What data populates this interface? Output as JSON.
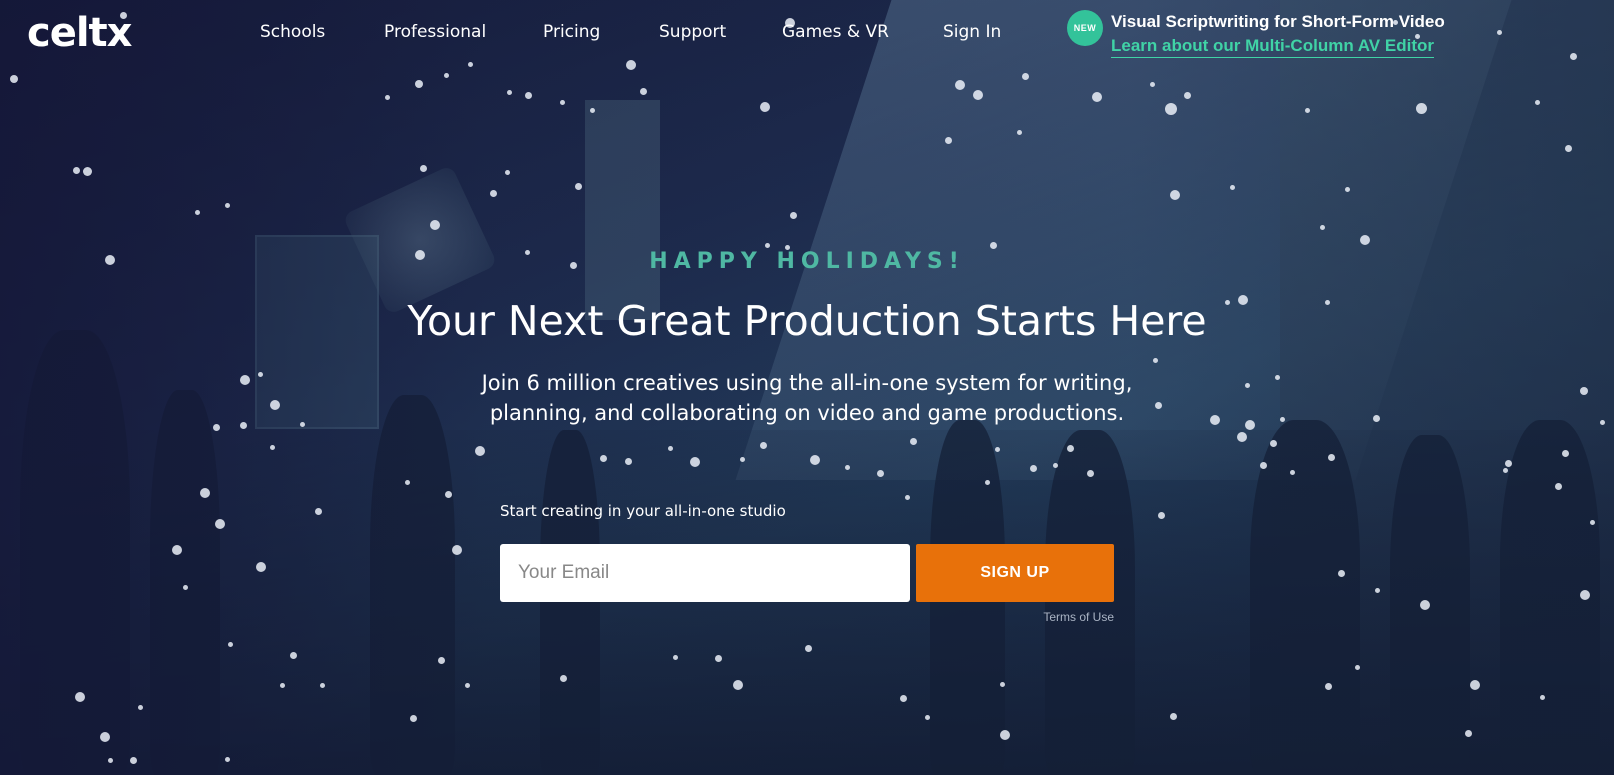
{
  "header": {
    "logo": "celtx",
    "nav": [
      {
        "label": "Schools"
      },
      {
        "label": "Professional"
      },
      {
        "label": "Pricing"
      },
      {
        "label": "Support"
      },
      {
        "label": "Games & VR"
      },
      {
        "label": "Sign In"
      }
    ],
    "promo": {
      "badge": "NEW",
      "title": "Visual Scriptwriting for Short-Form Video",
      "link": "Learn about our Multi-Column AV Editor"
    }
  },
  "hero": {
    "eyebrow": "HAPPY HOLIDAYS!",
    "headline": "Your Next Great Production Starts Here",
    "subhead_line1": "Join 6 million creatives using the all-in-one system for writing,",
    "subhead_line2": "planning, and collaborating on video and game productions.",
    "form_label": "Start creating in your all-in-one studio",
    "email_placeholder": "Your Email",
    "signup_label": "SIGN UP",
    "terms_label": "Terms of Use"
  },
  "colors": {
    "accent_teal": "#4fb8a3",
    "promo_green": "#40d3a6",
    "signup_orange": "#e8710a",
    "background_navy": "#1b2544"
  },
  "icons": {
    "promo_badge": "new-badge-icon",
    "background_effect": "snowflake-dots"
  }
}
